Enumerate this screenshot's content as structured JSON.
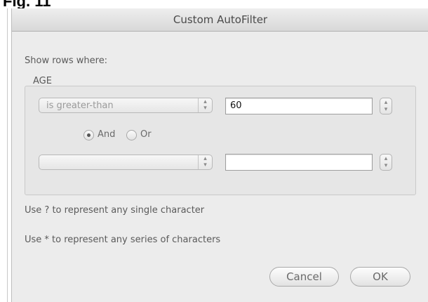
{
  "page": {
    "figure_label": "Fig. 11"
  },
  "dialog": {
    "title": "Custom AutoFilter",
    "prompt": "Show rows where:",
    "column_name": "AGE",
    "condition1": {
      "operator": "is greater-than",
      "value": "60"
    },
    "logic": {
      "and_label": "And",
      "or_label": "Or",
      "selected": "And"
    },
    "condition2": {
      "operator": "",
      "value": ""
    },
    "hint_single": "Use ? to represent any single character",
    "hint_series": "Use * to represent any series of characters",
    "cancel_label": "Cancel",
    "ok_label": "OK"
  },
  "icons": {
    "popup_arrows": "up-down-chevrons-icon",
    "stepper": "up-down-chevrons-icon",
    "radio_selected": "radio-selected-icon",
    "radio_unselected": "radio-unselected-icon"
  },
  "colors": {
    "dialog_background": "#ececec",
    "group_background": "#e6e6e6",
    "label_text": "#5a5a5a"
  }
}
